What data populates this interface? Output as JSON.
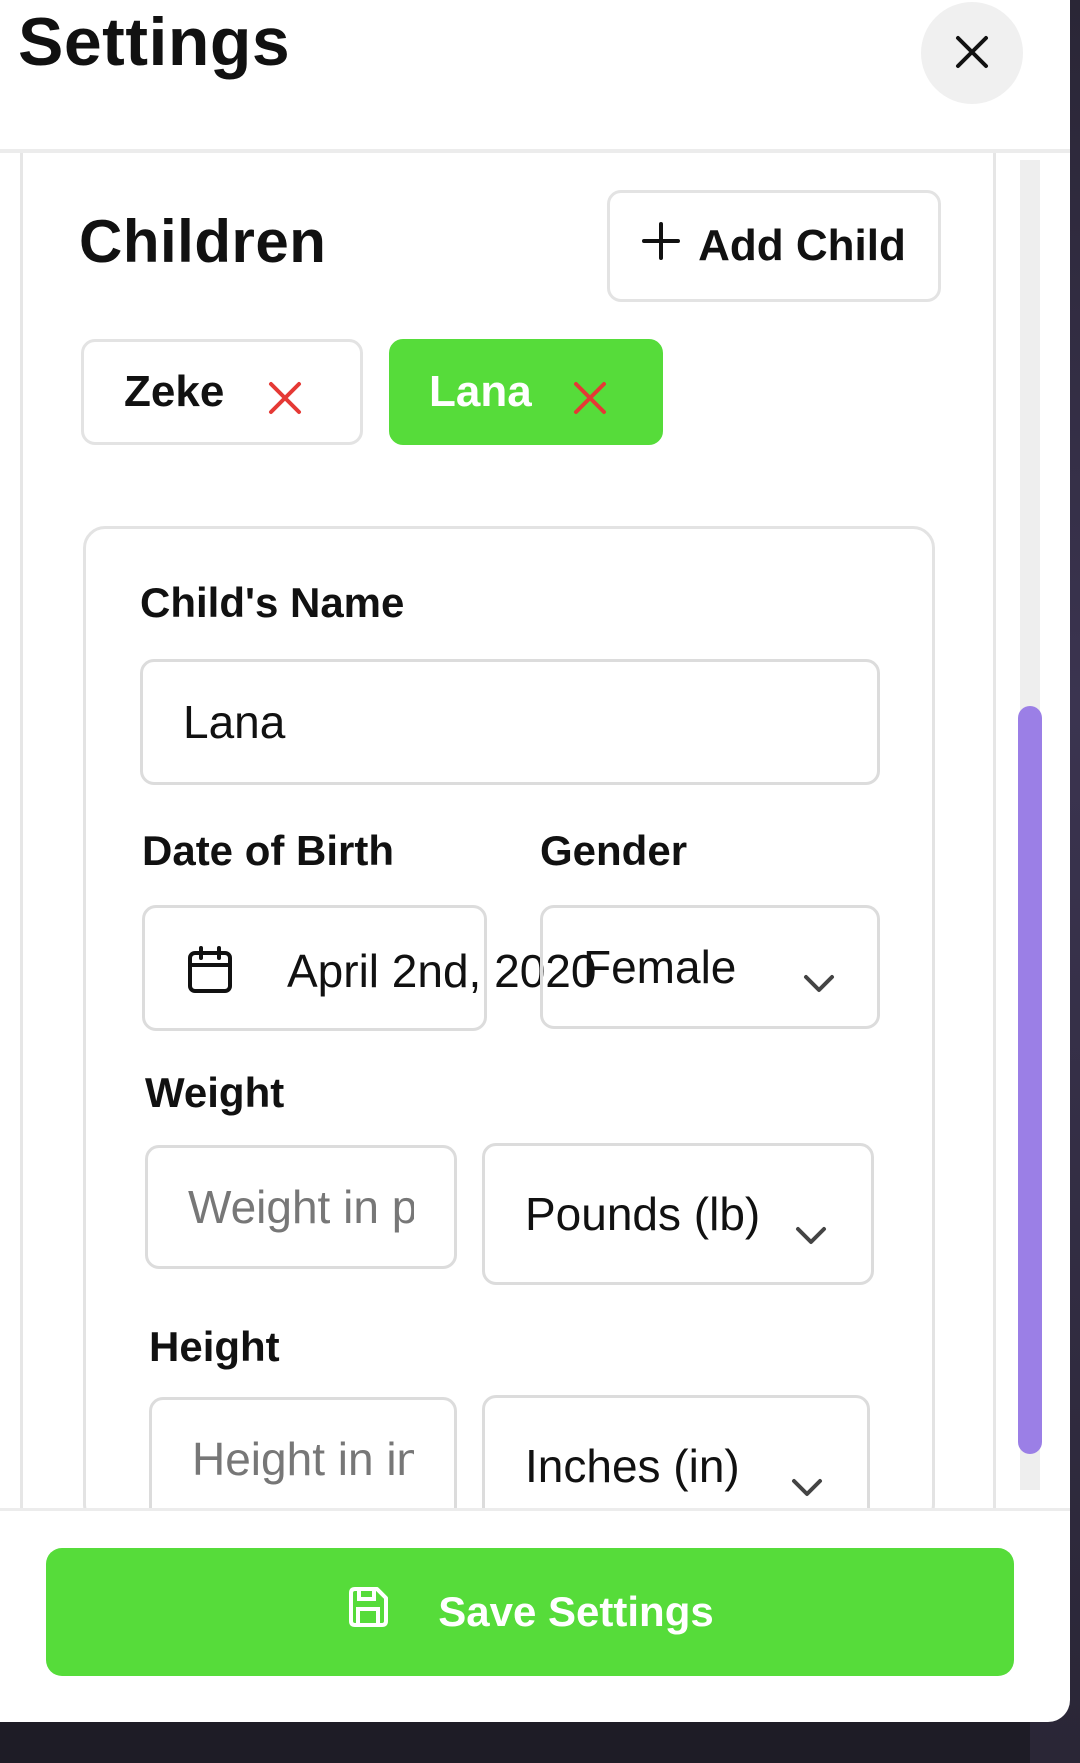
{
  "header": {
    "title": "Settings",
    "close_icon": "close-icon"
  },
  "children_section": {
    "title": "Children",
    "add_child_label": "Add Child",
    "add_icon": "plus-icon",
    "chips": [
      {
        "name": "Zeke",
        "selected": false,
        "remove_icon": "x-icon"
      },
      {
        "name": "Lana",
        "selected": true,
        "remove_icon": "x-icon"
      }
    ]
  },
  "form": {
    "name_label": "Child's Name",
    "name_value": "Lana",
    "dob_label": "Date of Birth",
    "dob_value": "April 2nd, 2020",
    "calendar_icon": "calendar-icon",
    "gender_label": "Gender",
    "gender_value": "Female",
    "weight_label": "Weight",
    "weight_placeholder": "Weight in pounds",
    "weight_unit": "Pounds (lb)",
    "height_label": "Height",
    "height_placeholder": "Height in inches",
    "height_unit": "Inches (in)"
  },
  "footer": {
    "save_label": "Save Settings",
    "save_icon": "save-icon"
  },
  "colors": {
    "accent": "#56dc3a",
    "remove": "#e53935",
    "scrollbar": "#9b7fe6"
  }
}
